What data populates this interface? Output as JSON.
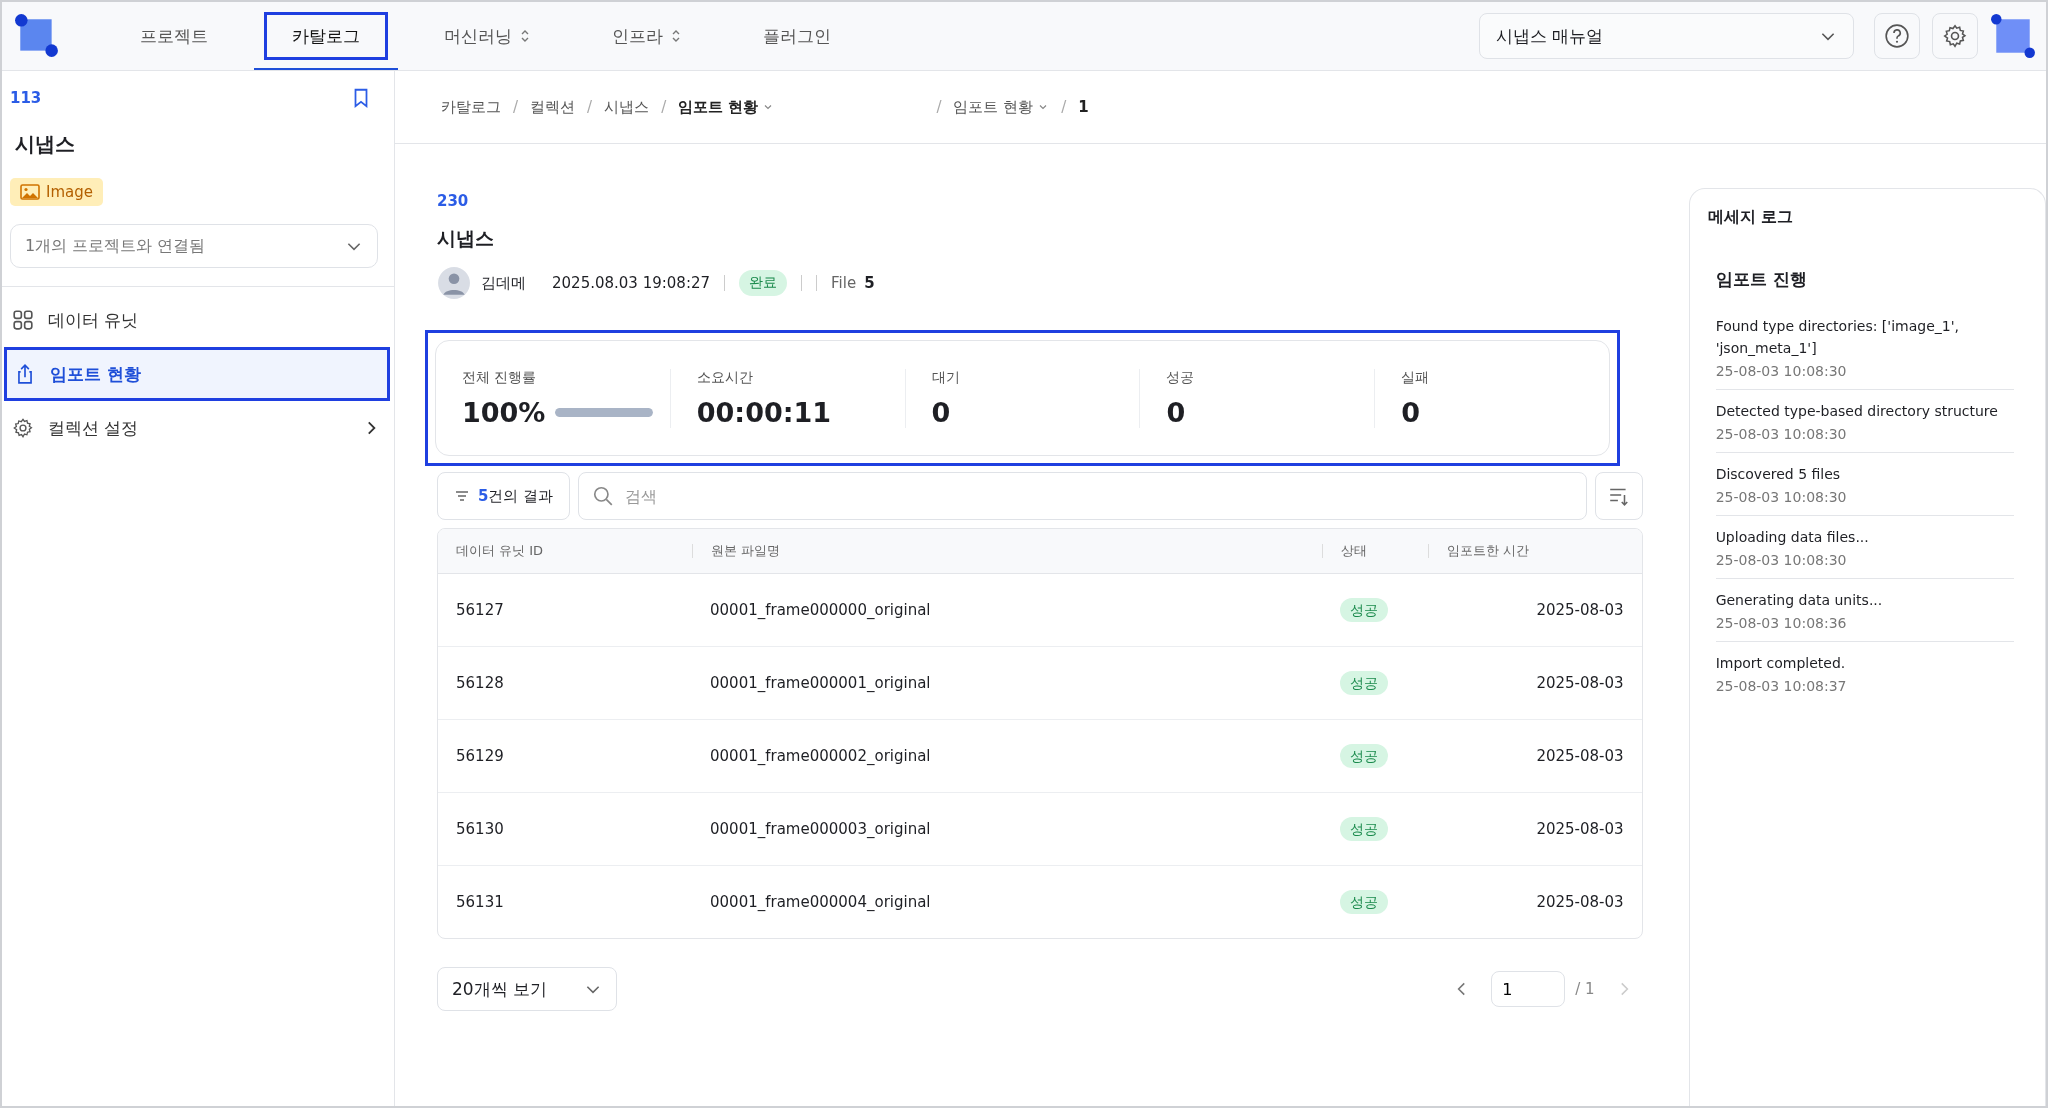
{
  "nav": {
    "tabs": [
      {
        "label": "프로젝트",
        "selected": false,
        "dropdown": false
      },
      {
        "label": "카탈로그",
        "selected": true,
        "dropdown": false
      },
      {
        "label": "머신러닝",
        "selected": false,
        "dropdown": true
      },
      {
        "label": "인프라",
        "selected": false,
        "dropdown": true
      },
      {
        "label": "플러그인",
        "selected": false,
        "dropdown": false
      }
    ],
    "manual_select": "시냅스 매뉴얼"
  },
  "sidebar": {
    "id": "113",
    "title": "시냅스",
    "type_tag": "Image",
    "project_select": "1개의 프로젝트와 연결됨",
    "items": [
      {
        "kind": "grid",
        "label": "데이터 유닛",
        "selected": false,
        "chevron": false
      },
      {
        "kind": "upload",
        "label": "임포트 현황",
        "selected": true,
        "chevron": false
      },
      {
        "kind": "gear",
        "label": "컬렉션 설정",
        "selected": false,
        "chevron": true
      }
    ]
  },
  "breadcrumb": {
    "separator": "/",
    "left": [
      {
        "label": "카탈로그",
        "current": false,
        "dropdown": false
      },
      {
        "label": "컬렉션",
        "current": false,
        "dropdown": false
      },
      {
        "label": "시냅스",
        "current": false,
        "dropdown": false
      },
      {
        "label": "임포트 현황",
        "current": true,
        "dropdown": true
      }
    ],
    "right": [
      {
        "label": "임포트 현황",
        "current": false,
        "dropdown": true
      },
      {
        "label": "1",
        "current": true,
        "dropdown": false
      }
    ]
  },
  "header": {
    "id": "230",
    "title": "시냅스",
    "author": "김데메",
    "datetime": "2025.08.03 19:08:27",
    "status": "완료",
    "file_label": "File",
    "file_count": "5"
  },
  "stats": {
    "highlighted": true,
    "items": [
      {
        "kind": "progress",
        "label": "전체 진행률",
        "value": "100%",
        "level": 1.0
      },
      {
        "kind": "count",
        "label": "소요시간",
        "value": "00:00:11"
      },
      {
        "kind": "count",
        "label": "대기",
        "value": "0"
      },
      {
        "kind": "count",
        "label": "성공",
        "value": "0"
      },
      {
        "kind": "count",
        "label": "실패",
        "value": "0"
      }
    ]
  },
  "toolbar": {
    "result_count": "**5**건의 결과",
    "search": {
      "placeholder": "검색"
    }
  },
  "table": {
    "columns": [
      "데이터 유닛 ID",
      "원본 파일명",
      "상태",
      "임포트한 시간"
    ],
    "rows": [
      {
        "id": "56127",
        "file": "00001_frame000000_original",
        "status": "성공",
        "time": "2025-08-03"
      },
      {
        "id": "56128",
        "file": "00001_frame000001_original",
        "status": "성공",
        "time": "2025-08-03"
      },
      {
        "id": "56129",
        "file": "00001_frame000002_original",
        "status": "성공",
        "time": "2025-08-03"
      },
      {
        "id": "56130",
        "file": "00001_frame000003_original",
        "status": "성공",
        "time": "2025-08-03"
      },
      {
        "id": "56131",
        "file": "00001_frame000004_original",
        "status": "성공",
        "time": "2025-08-03"
      }
    ]
  },
  "pagination": {
    "page_size": "20개씩 보기",
    "page": "1",
    "total": "/ 1"
  },
  "message_log": {
    "title": "메세지 로그",
    "section": "임포트 진행",
    "entries": [
      {
        "text": "Found type directories: ['image_1', 'json_meta_1']",
        "time": "25-08-03 10:08:30"
      },
      {
        "text": "Detected type-based directory structure",
        "time": "25-08-03 10:08:30"
      },
      {
        "text": "Discovered 5 files",
        "time": "25-08-03 10:08:30"
      },
      {
        "text": "Uploading data files...",
        "time": "25-08-03 10:08:30"
      },
      {
        "text": "Generating data units...",
        "time": "25-08-03 10:08:36"
      },
      {
        "text": "Import completed.",
        "time": "25-08-03 10:08:37"
      }
    ]
  }
}
